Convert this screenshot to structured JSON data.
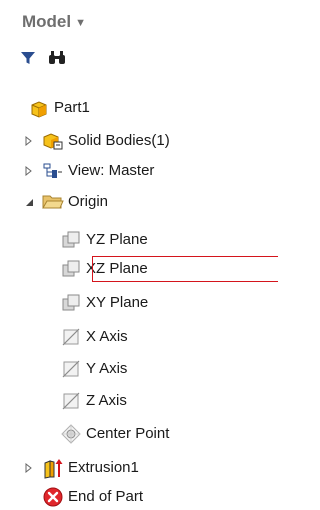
{
  "panel": {
    "title": "Model",
    "title_icon": "chevron-down-icon",
    "toolbar": [
      {
        "name": "filter-icon"
      },
      {
        "name": "find-binoculars-icon"
      }
    ]
  },
  "tree": {
    "root": {
      "label": "Part1",
      "icon": "part-cube-icon"
    },
    "items": [
      {
        "label": "Solid Bodies(1)",
        "icon": "solid-bodies-icon",
        "expander": "collapsed"
      },
      {
        "label": "View: Master",
        "icon": "view-representation-icon",
        "expander": "collapsed"
      },
      {
        "label": "Origin",
        "icon": "folder-open-icon",
        "expander": "expanded"
      },
      {
        "label": "YZ Plane",
        "icon": "work-plane-icon"
      },
      {
        "label": "XZ Plane",
        "icon": "work-plane-icon",
        "highlighted": true
      },
      {
        "label": "XY Plane",
        "icon": "work-plane-icon"
      },
      {
        "label": "X Axis",
        "icon": "work-axis-icon"
      },
      {
        "label": "Y Axis",
        "icon": "work-axis-icon"
      },
      {
        "label": "Z Axis",
        "icon": "work-axis-icon"
      },
      {
        "label": "Center Point",
        "icon": "work-point-icon"
      },
      {
        "label": "Extrusion1",
        "icon": "extrusion-icon",
        "expander": "collapsed"
      },
      {
        "label": "End of Part",
        "icon": "end-of-part-icon"
      }
    ]
  },
  "colors": {
    "highlight_border": "#d4141c",
    "folder": "#e8c26a",
    "part": "#f4b400",
    "end_of_part": "#e0262b"
  }
}
